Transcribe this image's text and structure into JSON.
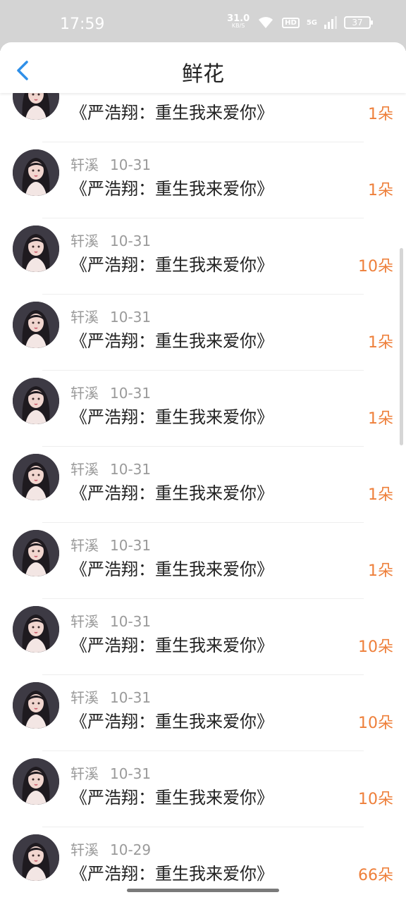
{
  "status": {
    "time": "17:59",
    "net_speed": "31.0",
    "net_unit": "KB/S",
    "hd": "HD",
    "signal": "5G",
    "battery": "37"
  },
  "header": {
    "title": "鲜花"
  },
  "colors": {
    "accent": "#ee7f3a",
    "back": "#2f8fe8",
    "muted": "#9a9a9a"
  },
  "items": [
    {
      "book": "《严浩翔：重生我来爱你》",
      "count": "1朵"
    },
    {
      "name": "轩溪",
      "date": "10-31",
      "book": "《严浩翔：重生我来爱你》",
      "count": "1朵"
    },
    {
      "name": "轩溪",
      "date": "10-31",
      "book": "《严浩翔：重生我来爱你》",
      "count": "10朵"
    },
    {
      "name": "轩溪",
      "date": "10-31",
      "book": "《严浩翔：重生我来爱你》",
      "count": "1朵"
    },
    {
      "name": "轩溪",
      "date": "10-31",
      "book": "《严浩翔：重生我来爱你》",
      "count": "1朵"
    },
    {
      "name": "轩溪",
      "date": "10-31",
      "book": "《严浩翔：重生我来爱你》",
      "count": "1朵"
    },
    {
      "name": "轩溪",
      "date": "10-31",
      "book": "《严浩翔：重生我来爱你》",
      "count": "1朵"
    },
    {
      "name": "轩溪",
      "date": "10-31",
      "book": "《严浩翔：重生我来爱你》",
      "count": "10朵"
    },
    {
      "name": "轩溪",
      "date": "10-31",
      "book": "《严浩翔：重生我来爱你》",
      "count": "10朵"
    },
    {
      "name": "轩溪",
      "date": "10-31",
      "book": "《严浩翔：重生我来爱你》",
      "count": "10朵"
    },
    {
      "name": "轩溪",
      "date": "10-29",
      "book": "《严浩翔：重生我来爱你》",
      "count": "66朵"
    }
  ]
}
